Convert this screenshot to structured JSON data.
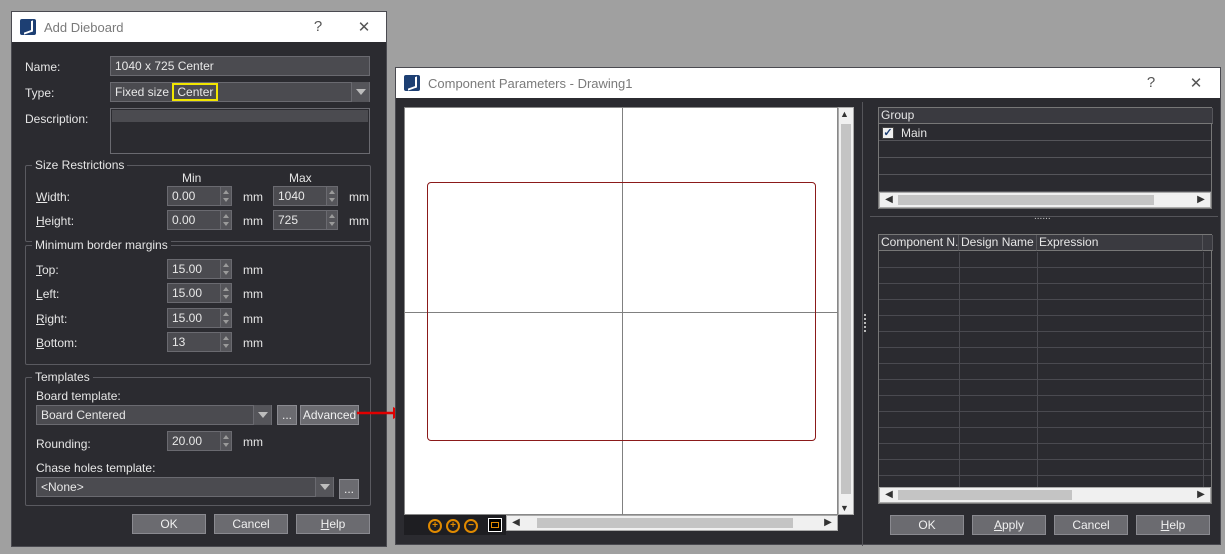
{
  "dialog1": {
    "title": "Add Dieboard",
    "help_btn": "?",
    "close_btn": "✕",
    "name_label": "Name:",
    "name_value": "1040 x 725 Center",
    "type_label": "Type:",
    "type_value_prefix": "Fixed size",
    "type_value_highlight": "Center",
    "description_label": "Description:",
    "size": {
      "legend": "Size Restrictions",
      "min_header": "Min",
      "max_header": "Max",
      "width_label": "Width:",
      "height_label": "Height:",
      "width_min": "0.00",
      "width_max": "1040",
      "height_min": "0.00",
      "height_max": "725",
      "unit": "mm"
    },
    "margins": {
      "legend": "Minimum border margins",
      "top_label": "Top:",
      "left_label": "Left:",
      "right_label": "Right:",
      "bottom_label": "Bottom:",
      "top": "15.00",
      "left": "15.00",
      "right": "15.00",
      "bottom": "13",
      "unit": "mm"
    },
    "templates": {
      "legend": "Templates",
      "board_label": "Board template:",
      "board_value": "Board Centered",
      "browse": "...",
      "advanced": "Advanced",
      "rounding_label": "Rounding:",
      "rounding_value": "20.00",
      "unit": "mm",
      "chase_label": "Chase holes template:",
      "chase_value": "<None>"
    },
    "ok": "OK",
    "cancel": "Cancel",
    "help": "Help"
  },
  "dialog2": {
    "title": "Component Parameters - Drawing1",
    "help_btn": "?",
    "close_btn": "✕",
    "group_header": "Group",
    "group_item": "Main",
    "splitter_dots": "......",
    "table_headers": [
      "Component N...",
      "Design Name",
      "Expression"
    ],
    "ok": "OK",
    "apply": "Apply",
    "cancel": "Cancel",
    "help": "Help"
  },
  "colors": {
    "board_outline": "#8b1a1a",
    "highlight_box": "#f2e600",
    "arrow": "#e00000"
  }
}
